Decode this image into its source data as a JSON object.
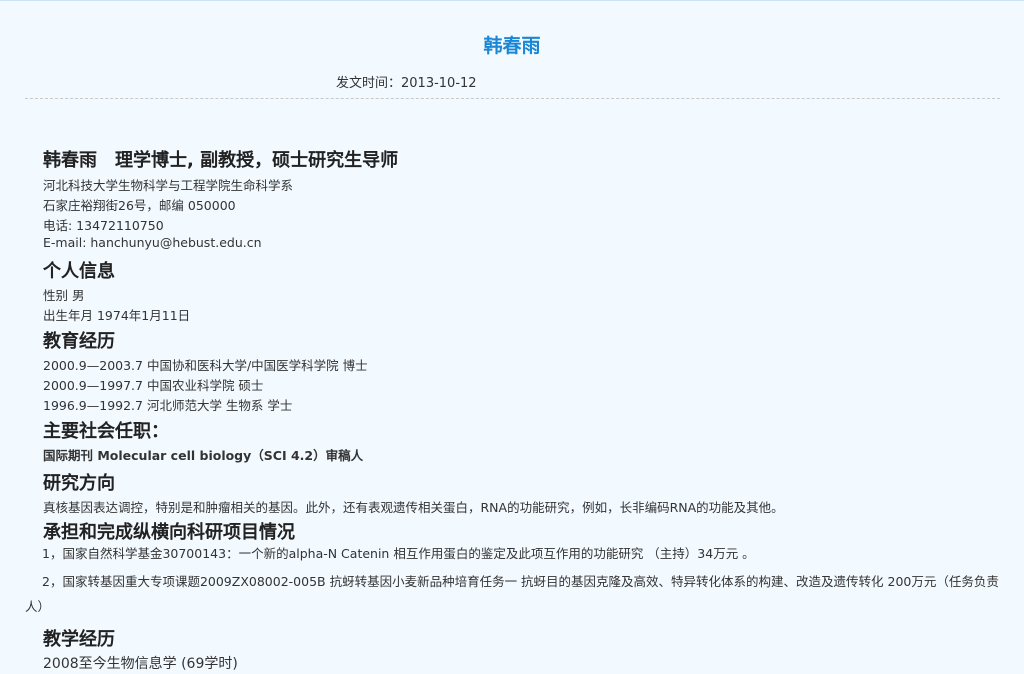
{
  "article": {
    "title": "韩春雨",
    "date_label": "发文时间：2013-10-12"
  },
  "profile": {
    "heading": "韩春雨　理学博士, 副教授，硕士研究生导师",
    "lines": [
      "河北科技大学生物科学与工程学院生命科学系",
      "石家庄裕翔街26号，邮编 050000",
      "电话: 13472110750",
      "E-mail: hanchunyu@hebust.edu.cn"
    ]
  },
  "personal": {
    "heading": "个人信息",
    "lines": [
      "性别  男",
      "出生年月   1974年1月11日"
    ]
  },
  "education": {
    "heading": "教育经历",
    "lines": [
      "2000.9—2003.7   中国协和医科大学/中国医学科学院   博士",
      "2000.9—1997.7   中国农业科学院   硕士",
      "1996.9—1992.7   河北师范大学   生物系   学士"
    ]
  },
  "service": {
    "heading": "主要社会任职：",
    "lines": [
      "国际期刊 Molecular cell biology（SCI 4.2）审稿人"
    ]
  },
  "research": {
    "heading": "研究方向",
    "text": "真核基因表达调控，特别是和肿瘤相关的基因。此外，还有表观遗传相关蛋白，RNA的功能研究，例如，长非编码RNA的功能及其他。"
  },
  "projects": {
    "heading": "承担和完成纵横向科研项目情况",
    "items": [
      "1，国家自然科学基金30700143：一个新的alpha-N Catenin 相互作用蛋白的鉴定及此项互作用的功能研究 （主持）34万元 。",
      "2，国家转基因重大专项课题2009ZX08002-005B 抗蚜转基因小麦新品种培育任务一 抗蚜目的基因克隆及高效、特异转化体系的构建、改造及遗传转化 200万元（任务负责人）"
    ]
  },
  "teaching": {
    "heading": "教学经历",
    "lines": [
      "2008至今生物信息学 (69学时)"
    ]
  }
}
